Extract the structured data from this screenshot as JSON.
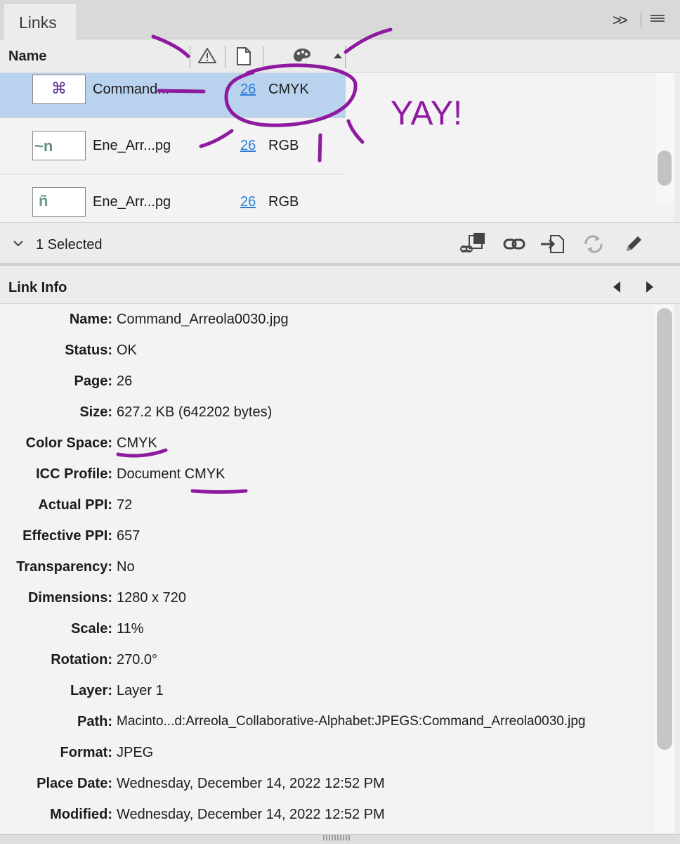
{
  "tab": {
    "title": "Links",
    "collapse_glyph": ">>"
  },
  "columns": {
    "name": "Name",
    "status_icon": "warning-icon",
    "page_icon": "page-icon",
    "color_icon": "palette-icon",
    "sort_icon": "sort-ascending-icon"
  },
  "links": [
    {
      "name": "Command...",
      "page": "26",
      "color_space": "CMYK",
      "selected": true,
      "thumb_glyph": "⌘"
    },
    {
      "name": "Ene_Arr...pg",
      "page": "26",
      "color_space": "RGB",
      "selected": false,
      "thumb_glyph": "~n"
    },
    {
      "name": "Ene_Arr...pg",
      "page": "26",
      "color_space": "RGB",
      "selected": false,
      "thumb_glyph": "ñ"
    }
  ],
  "selection": {
    "label": "1 Selected",
    "tools": [
      "relink-from-cc-icon",
      "relink-icon",
      "go-to-link-icon",
      "update-link-icon",
      "edit-original-icon"
    ]
  },
  "link_info": {
    "title": "Link Info",
    "fields": [
      {
        "label": "Name:",
        "value": "Command_Arreola0030.jpg"
      },
      {
        "label": "Status:",
        "value": "OK"
      },
      {
        "label": "Page:",
        "value": "26"
      },
      {
        "label": "Size:",
        "value": "627.2 KB (642202 bytes)"
      },
      {
        "label": "Color Space:",
        "value": "CMYK"
      },
      {
        "label": "ICC Profile:",
        "value": "Document CMYK"
      },
      {
        "label": "Actual PPI:",
        "value": "72"
      },
      {
        "label": "Effective PPI:",
        "value": "657"
      },
      {
        "label": "Transparency:",
        "value": "No"
      },
      {
        "label": "Dimensions:",
        "value": "1280 x 720"
      },
      {
        "label": "Scale:",
        "value": "11%"
      },
      {
        "label": "Rotation:",
        "value": "270.0°"
      },
      {
        "label": "Layer:",
        "value": "Layer 1"
      },
      {
        "label": "Path:",
        "value": "Macinto...d:Arreola_Collaborative-Alphabet:JPEGS:Command_Arreola0030.jpg"
      },
      {
        "label": "Format:",
        "value": "JPEG"
      },
      {
        "label": "Place Date:",
        "value": "Wednesday, December 14, 2022 12:52 PM"
      },
      {
        "label": "Modified:",
        "value": "Wednesday, December 14, 2022 12:52 PM"
      }
    ]
  },
  "annotation": {
    "text": "YAY!",
    "color": "#8e1aa0"
  },
  "colors": {
    "selection": "#b9d2ee",
    "page_link": "#2b7fd8",
    "annotation": "#8e1aa0"
  }
}
